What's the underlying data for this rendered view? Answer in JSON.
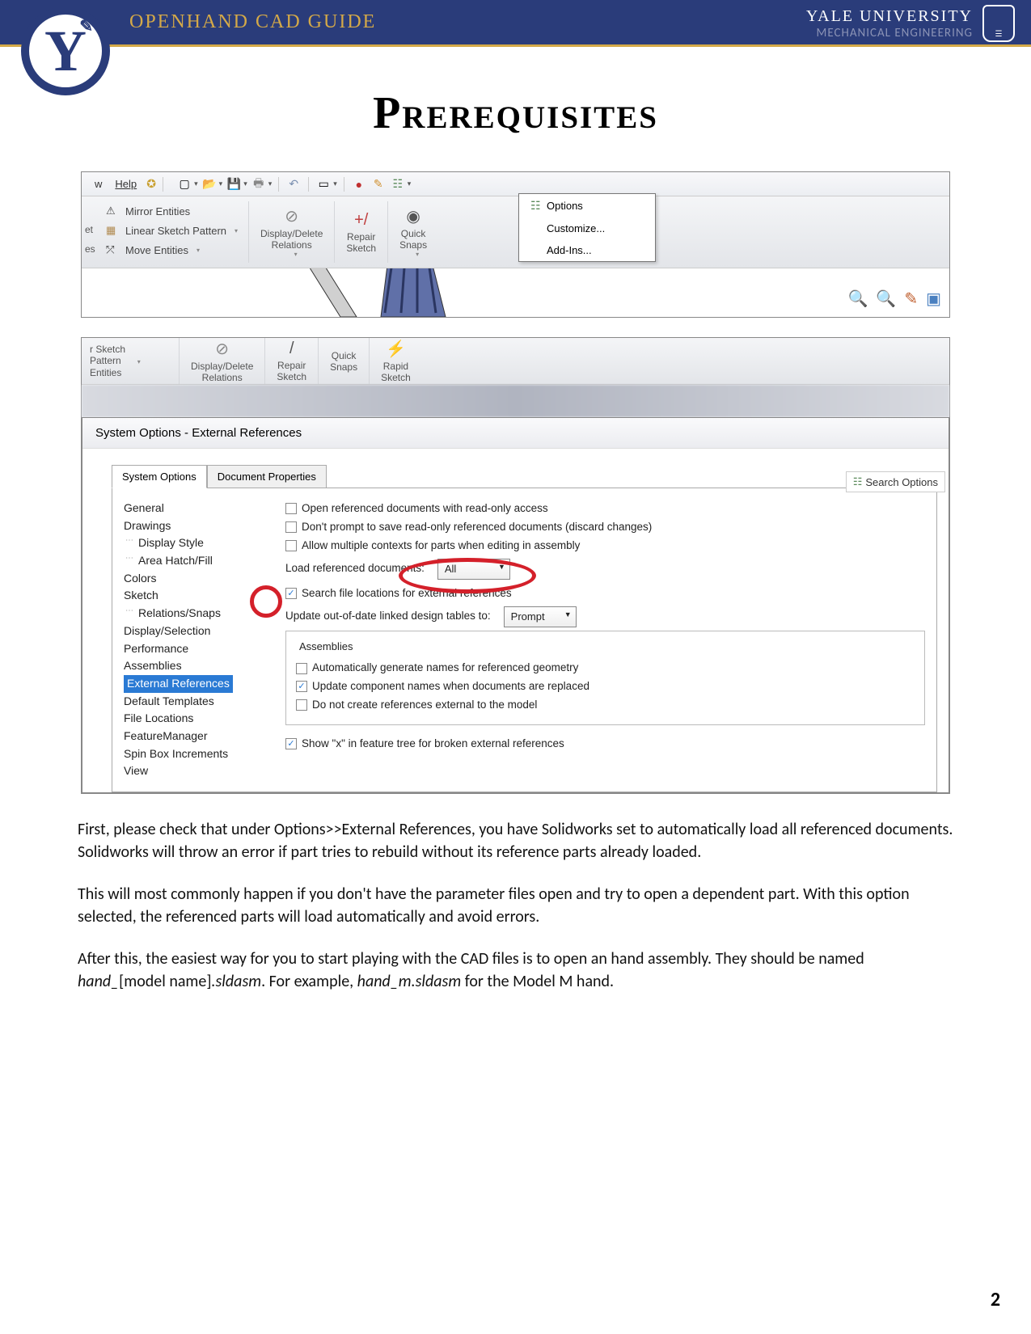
{
  "header": {
    "guide_title": "OPENHAND CAD GUIDE",
    "university": "YALE UNIVERSITY",
    "department": "MECHANICAL ENGINEERING",
    "logo_letter": "Y"
  },
  "page_title": "Prerequisites",
  "screenshot1": {
    "menus": {
      "w": "w",
      "help": "Help"
    },
    "ribbon_left_prefix": {
      "et": "et",
      "es": "es"
    },
    "ribbon_items": [
      "Mirror Entities",
      "Linear Sketch Pattern",
      "Move Entities"
    ],
    "tools": {
      "display_delete": "Display/Delete\nRelations",
      "repair": "Repair\nSketch",
      "quick": "Quick\nSnaps"
    },
    "dropdown": [
      "Options",
      "Customize...",
      "Add-Ins..."
    ]
  },
  "screenshot2": {
    "ribbon_left": {
      "sketch_pattern": "r Sketch Pattern",
      "entities": "Entities"
    },
    "tools": {
      "display_delete": "Display/Delete\nRelations",
      "repair": "Repair\nSketch",
      "quick": "Quick\nSnaps",
      "rapid": "Rapid\nSketch"
    },
    "dialog_title": "System Options - External References",
    "search_options": "Search Options",
    "tabs": [
      "System Options",
      "Document Properties"
    ],
    "tree": [
      "General",
      "Drawings",
      "Display Style",
      "Area Hatch/Fill",
      "Colors",
      "Sketch",
      "Relations/Snaps",
      "Display/Selection",
      "Performance",
      "Assemblies",
      "External References",
      "Default Templates",
      "File Locations",
      "FeatureManager",
      "Spin Box Increments",
      "View"
    ],
    "settings": {
      "cb1": "Open referenced documents with read-only access",
      "cb2": "Don't prompt to save read-only referenced documents (discard changes)",
      "cb3": "Allow multiple contexts for parts when editing in assembly",
      "load_ref": "Load referenced documents:",
      "load_ref_value": "All",
      "cb4": "Search file locations for external references",
      "update_tables": "Update out-of-date linked design tables to:",
      "update_tables_value": "Prompt",
      "assemblies_legend": "Assemblies",
      "acb1": "Automatically generate names for referenced geometry",
      "acb2": "Update component names when documents are replaced",
      "acb3": "Do not create references external to the model",
      "cb5": "Show \"x\" in feature tree for broken external references"
    }
  },
  "body": {
    "p1": "First, please check that under Options>>External References, you have Solidworks set to automatically load all referenced documents. Solidworks will throw an error if part tries to rebuild without its reference parts already loaded.",
    "p2": "This will most commonly happen if you don't have the parameter files open and try to open a dependent part. With this option selected, the referenced parts will load automatically and avoid errors.",
    "p3a": "After this, the easiest way for you to start playing with the CAD files is to open an hand assembly. They should be named ",
    "p3b": "hand_",
    "p3c": "[model name]",
    "p3d": ".sldasm",
    "p3e": ". For example, ",
    "p3f": "hand_m.sldasm",
    "p3g": " for the Model M hand."
  },
  "page_number": "2"
}
